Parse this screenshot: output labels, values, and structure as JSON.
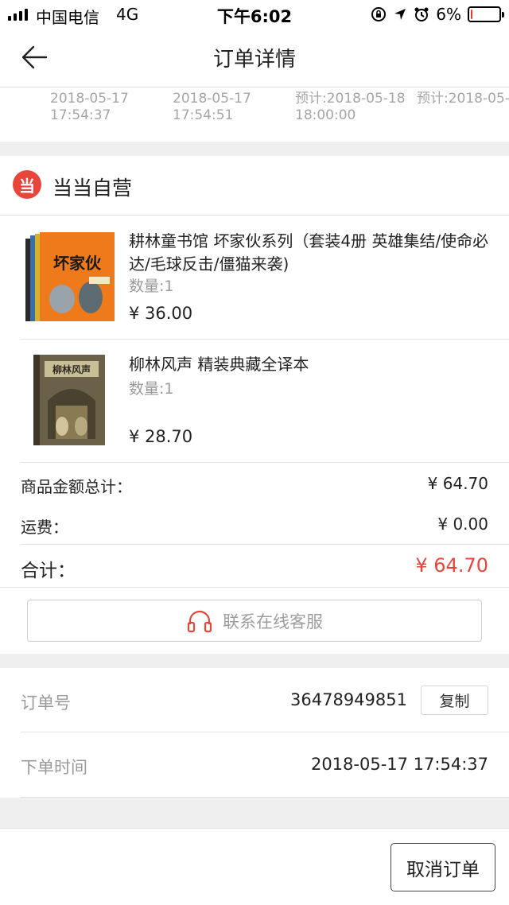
{
  "status_bar": {
    "carrier": "中国电信",
    "network": "4G",
    "time": "下午6:02",
    "battery_pct": "6%",
    "battery_level": 0.06,
    "icons": [
      "rotation-lock-icon",
      "location-arrow-icon",
      "alarm-icon"
    ]
  },
  "nav": {
    "title": "订单详情",
    "back_icon": "arrow-left-icon"
  },
  "timeline": [
    {
      "line1": "2018-05-17",
      "line2": "17:54:37"
    },
    {
      "line1": "2018-05-17",
      "line2": "17:54:51"
    },
    {
      "line1": "预计:2018-05-18",
      "line2": "18:00:00"
    },
    {
      "line1": "预计:2018-05-",
      "line2": ""
    }
  ],
  "store": {
    "logo_char": "当",
    "name": "当当自营"
  },
  "products": [
    {
      "title": "耕林童书馆 坏家伙系列（套装4册 英雄集结/使命必达/毛球反击/僵猫来袭)",
      "cover_text": "坏家伙",
      "qty": "数量:1",
      "price": "¥ 36.00"
    },
    {
      "title": "柳林风声 精装典藏全译本",
      "cover_text": "柳林风声",
      "qty": "数量:1",
      "price": "¥ 28.70"
    }
  ],
  "totals": {
    "subtotal_label": "商品金额总计：",
    "subtotal_value": "¥ 64.70",
    "shipping_label": "运费：",
    "shipping_value": "¥ 0.00",
    "total_label": "合计：",
    "total_value": "¥ 64.70"
  },
  "service": {
    "label": "联系在线客服",
    "icon": "headset-icon"
  },
  "order_info": {
    "order_no_label": "订单号",
    "order_no_value": "36478949851",
    "copy_label": "复制",
    "time_label": "下单时间",
    "time_value": "2018-05-17 17:54:37"
  },
  "actions": {
    "cancel_label": "取消订单"
  },
  "colors": {
    "accent": "#e8463b",
    "divider": "#e2e2e2",
    "gap": "#efefef",
    "muted_text": "#9a9a9a"
  }
}
